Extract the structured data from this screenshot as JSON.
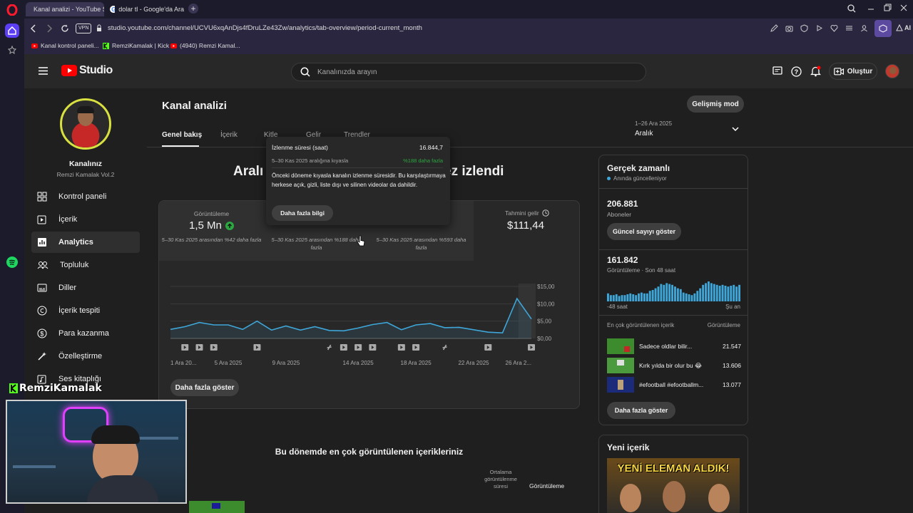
{
  "browser": {
    "tabs": [
      {
        "label": "Kanal analizi - YouTube St",
        "active": true
      },
      {
        "label": "dolar tl - Google'da Ara",
        "active": false
      }
    ],
    "vpn_label": "VPN",
    "url": "studio.youtube.com/channel/UCVU6xqAnDjs4fDruLZe43Zw/analytics/tab-overview/period-current_month",
    "ai_label": "AI",
    "bookmarks": [
      "Kanal kontrol paneli...",
      "RemziKamalak | Kick",
      "(4940) Remzi Kamal..."
    ]
  },
  "studio": {
    "logo_text": "Studio",
    "search_placeholder": "Kanalınızda arayın",
    "create_label": "Oluştur"
  },
  "channel": {
    "label": "Kanalınız",
    "name": "Remzi Kamalak Vol.2"
  },
  "sidebar": {
    "items": [
      {
        "label": "Kontrol paneli"
      },
      {
        "label": "İçerik"
      },
      {
        "label": "Analytics"
      },
      {
        "label": "Topluluk"
      },
      {
        "label": "Diller"
      },
      {
        "label": "İçerik tespiti"
      },
      {
        "label": "Para kazanma"
      },
      {
        "label": "Özelleştirme"
      },
      {
        "label": "Ses kitaplığı"
      }
    ]
  },
  "overlay": {
    "streamer_name": "RemziKamalak"
  },
  "analytics": {
    "page_title": "Kanal analizi",
    "advanced_mode": "Gelişmiş mod",
    "tabs": [
      "Genel bakış",
      "İçerik",
      "Kitle",
      "Gelir",
      "Trendler"
    ],
    "period": {
      "range": "1–26 Ara 2025",
      "label": "Aralık"
    },
    "headline_left": "Aralı",
    "headline_right": "ez izlendi",
    "metrics": [
      {
        "label": "Görüntüleme",
        "value": "1,5 Mn",
        "compare": "5–30 Kas 2025 arasından %42 daha fazla"
      },
      {
        "label": "",
        "value": "",
        "compare": "5–30 Kas 2025 arasından %188 daha fazla"
      },
      {
        "label": "",
        "value": "",
        "compare": "5–30 Kas 2025 arasından %593 daha fazla"
      },
      {
        "label": "Tahmini gelir",
        "value": "$111,44",
        "compare": ""
      }
    ],
    "more_button": "Daha fazla göster",
    "tooltip": {
      "title": "İzlenme süresi (saat)",
      "value": "16.844,7",
      "compare_label": "5–30 Kas 2025 aralığına kıyasla",
      "compare_value": "%188 daha fazla",
      "description": "Önceki döneme kıyasla kanalın izlenme süresidir. Bu karşılaştırmaya herkese açık, gizli, liste dışı ve silinen videolar da dahildir.",
      "learn_more": "Daha fazla bilgi"
    },
    "top_content_title": "Bu dönemde en çok görüntülenen içerikleriniz",
    "top_content_columns": [
      "Ortalama görüntülenme süresi",
      "Görüntüleme"
    ]
  },
  "chart_data": {
    "type": "line",
    "x": [
      "1 Ara 2025",
      "2 Ara 2025",
      "3 Ara 2025",
      "4 Ara 2025",
      "5 Ara 2025",
      "6 Ara 2025",
      "7 Ara 2025",
      "8 Ara 2025",
      "9 Ara 2025",
      "10 Ara 2025",
      "11 Ara 2025",
      "12 Ara 2025",
      "13 Ara 2025",
      "14 Ara 2025",
      "15 Ara 2025",
      "16 Ara 2025",
      "17 Ara 2025",
      "18 Ara 2025",
      "19 Ara 2025",
      "20 Ara 2025",
      "21 Ara 2025",
      "22 Ara 2025",
      "23 Ara 2025",
      "24 Ara 2025",
      "25 Ara 2025",
      "26 Ara 2025"
    ],
    "x_tick_labels": [
      "1 Ara 20...",
      "5 Ara 2025",
      "9 Ara 2025",
      "14 Ara 2025",
      "18 Ara 2025",
      "22 Ara 2025",
      "26 Ara 2..."
    ],
    "series": [
      {
        "values": [
          2.6,
          3.4,
          4.6,
          3.9,
          3.9,
          2.6,
          5.0,
          2.4,
          3.6,
          2.4,
          3.4,
          2.3,
          2.2,
          3.0,
          4.0,
          4.6,
          2.5,
          3.9,
          4.3,
          3.1,
          3.2,
          2.5,
          1.8,
          1.6,
          11.5,
          5.6
        ]
      }
    ],
    "y_tick_labels": [
      "$15,00",
      "$10,00",
      "$5,00",
      "$0,00"
    ],
    "ylim": [
      0,
      15
    ],
    "grid": true,
    "color": "#3ea6d8"
  },
  "realtime": {
    "title": "Gerçek zamanlı",
    "subtitle": "Anında güncelleniyor",
    "subscribers": "206.881",
    "subscribers_label": "Aboneler",
    "show_live_count": "Güncel sayıyı göster",
    "views": "161.842",
    "views_label": "Görüntüleme · Son 48 saat",
    "axis_start": "-48 saat",
    "axis_end": "Şu an",
    "bars": [
      0.3,
      0.2,
      0.2,
      0.25,
      0.15,
      0.2,
      0.2,
      0.25,
      0.3,
      0.25,
      0.2,
      0.3,
      0.35,
      0.3,
      0.3,
      0.45,
      0.5,
      0.6,
      0.7,
      0.85,
      0.8,
      0.9,
      0.85,
      0.8,
      0.7,
      0.6,
      0.55,
      0.35,
      0.3,
      0.25,
      0.2,
      0.3,
      0.45,
      0.6,
      0.8,
      0.9,
      1.0,
      0.9,
      0.85,
      0.8,
      0.75,
      0.8,
      0.75,
      0.7,
      0.75,
      0.8,
      0.7,
      0.8
    ],
    "top_header": "En çok görüntülenen içerik",
    "top_header_right": "Görüntüleme",
    "top_items": [
      {
        "title": "Sadece oldlar bilir...",
        "views": "21.547"
      },
      {
        "title": "Kırk yılda bir olur bu 😂",
        "views": "13.606"
      },
      {
        "title": "#efootball #efootballm...",
        "views": "13.077"
      }
    ],
    "more_button": "Daha fazla göster"
  },
  "new_content": {
    "title": "Yeni içerik",
    "thumb_text": "YENİ ELEMAN ALDIK!"
  },
  "colors": {
    "accent": "#3ea6d8",
    "positive": "#2ba640",
    "youtube_red": "#ff0000"
  }
}
